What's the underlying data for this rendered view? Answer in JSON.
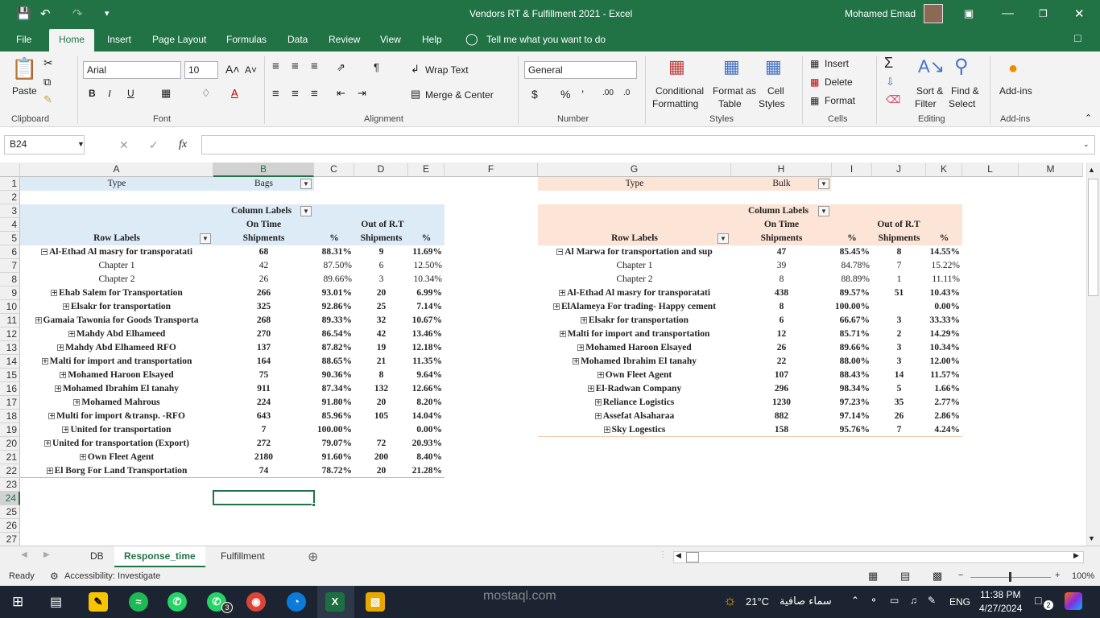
{
  "window": {
    "title": "Vendors RT & Fulfillment 2021  -  Excel",
    "user": "Mohamed Emad"
  },
  "tabs": [
    "File",
    "Home",
    "Insert",
    "Page Layout",
    "Formulas",
    "Data",
    "Review",
    "View",
    "Help"
  ],
  "tell_me": "Tell me what you want to do",
  "ribbon": {
    "paste": "Paste",
    "clipboard": "Clipboard",
    "font_name": "Arial",
    "font_size": "10",
    "font": "Font",
    "wrap_text": "Wrap Text",
    "merge_center": "Merge & Center",
    "alignment": "Alignment",
    "number_format": "General",
    "number": "Number",
    "conditional": "Conditional",
    "formatting": "Formatting",
    "format_as": "Format as",
    "table": "Table",
    "cell": "Cell",
    "styles_btn": "Styles",
    "styles": "Styles",
    "insert": "Insert",
    "delete": "Delete",
    "format": "Format",
    "cells": "Cells",
    "sort": "Sort &",
    "filter": "Filter",
    "find": "Find &",
    "select": "Select",
    "editing": "Editing",
    "addins": "Add-ins",
    "addins_grp": "Add-ins"
  },
  "formula": {
    "namebox": "B24",
    "value": ""
  },
  "columns": [
    "A",
    "B",
    "C",
    "D",
    "E",
    "F",
    "G",
    "H",
    "I",
    "J",
    "K",
    "L",
    "M"
  ],
  "rows": [
    "1",
    "2",
    "3",
    "4",
    "5",
    "6",
    "7",
    "8",
    "9",
    "10",
    "11",
    "12",
    "13",
    "14",
    "15",
    "16",
    "17",
    "18",
    "19",
    "20",
    "21",
    "22",
    "23",
    "24",
    "25",
    "26",
    "27"
  ],
  "left": {
    "type_label": "Type",
    "type_value": "Bags",
    "column_labels": "Column Labels",
    "on_time": "On Time",
    "out_of": "Out of R.T",
    "row_labels": "Row Labels",
    "shipments": "Shipments",
    "pct": "%",
    "rows": [
      [
        "Al-Ethad Al masry for transporatati",
        "68",
        "88.31%",
        "9",
        "11.69%",
        "minus",
        1
      ],
      [
        "Chapter 1",
        "42",
        "87.50%",
        "6",
        "12.50%",
        "",
        0
      ],
      [
        "Chapter 2",
        "26",
        "89.66%",
        "3",
        "10.34%",
        "",
        0
      ],
      [
        "Ehab Salem for Transportation",
        "266",
        "93.01%",
        "20",
        "6.99%",
        "plus",
        1
      ],
      [
        "Elsakr for transportation",
        "325",
        "92.86%",
        "25",
        "7.14%",
        "plus",
        1
      ],
      [
        "Gamaia Tawonia for Goods Transporta",
        "268",
        "89.33%",
        "32",
        "10.67%",
        "plus",
        1
      ],
      [
        "Mahdy Abd Elhameed",
        "270",
        "86.54%",
        "42",
        "13.46%",
        "plus",
        1
      ],
      [
        "Mahdy Abd Elhameed RFO",
        "137",
        "87.82%",
        "19",
        "12.18%",
        "plus",
        1
      ],
      [
        "Malti for import and transportation",
        "164",
        "88.65%",
        "21",
        "11.35%",
        "plus",
        1
      ],
      [
        "Mohamed Haroon Elsayed",
        "75",
        "90.36%",
        "8",
        "9.64%",
        "plus",
        1
      ],
      [
        "Mohamed Ibrahim El tanahy",
        "911",
        "87.34%",
        "132",
        "12.66%",
        "plus",
        1
      ],
      [
        "Mohamed Mahrous",
        "224",
        "91.80%",
        "20",
        "8.20%",
        "plus",
        1
      ],
      [
        "Multi for import &transp. -RFO",
        "643",
        "85.96%",
        "105",
        "14.04%",
        "plus",
        1
      ],
      [
        "United for transportation",
        "7",
        "100.00%",
        "",
        "0.00%",
        "plus",
        1
      ],
      [
        "United for transportation (Export)",
        "272",
        "79.07%",
        "72",
        "20.93%",
        "plus",
        1
      ],
      [
        "Own Fleet Agent",
        "2180",
        "91.60%",
        "200",
        "8.40%",
        "plus",
        1
      ],
      [
        "El Borg For Land Transportation",
        "74",
        "78.72%",
        "20",
        "21.28%",
        "plus",
        1
      ]
    ]
  },
  "right": {
    "type_label": "Type",
    "type_value": "Bulk",
    "column_labels": "Column Labels",
    "on_time": "On Time",
    "out_of": "Out of R.T",
    "row_labels": "Row Labels",
    "shipments": "Shipments",
    "pct": "%",
    "rows": [
      [
        "Al Marwa for transportation and sup",
        "47",
        "85.45%",
        "8",
        "14.55%",
        "minus",
        1
      ],
      [
        "Chapter 1",
        "39",
        "84.78%",
        "7",
        "15.22%",
        "",
        0
      ],
      [
        "Chapter 2",
        "8",
        "88.89%",
        "1",
        "11.11%",
        "",
        0
      ],
      [
        "Al-Ethad Al masry for transporatati",
        "438",
        "89.57%",
        "51",
        "10.43%",
        "plus",
        1
      ],
      [
        "ElAlameya For trading- Happy cement",
        "8",
        "100.00%",
        "",
        "0.00%",
        "plus",
        1
      ],
      [
        "Elsakr for transportation",
        "6",
        "66.67%",
        "3",
        "33.33%",
        "plus",
        1
      ],
      [
        "Malti for import and transportation",
        "12",
        "85.71%",
        "2",
        "14.29%",
        "plus",
        1
      ],
      [
        "Mohamed Haroon Elsayed",
        "26",
        "89.66%",
        "3",
        "10.34%",
        "plus",
        1
      ],
      [
        "Mohamed Ibrahim El tanahy",
        "22",
        "88.00%",
        "3",
        "12.00%",
        "plus",
        1
      ],
      [
        "Own Fleet Agent",
        "107",
        "88.43%",
        "14",
        "11.57%",
        "plus",
        1
      ],
      [
        "El-Radwan Company",
        "296",
        "98.34%",
        "5",
        "1.66%",
        "plus",
        1
      ],
      [
        "Reliance Logistics",
        "1230",
        "97.23%",
        "35",
        "2.77%",
        "plus",
        1
      ],
      [
        "Assefat Alsaharaa",
        "882",
        "97.14%",
        "26",
        "2.86%",
        "plus",
        1
      ],
      [
        "Sky Logestics",
        "158",
        "95.76%",
        "7",
        "4.24%",
        "plus",
        1
      ]
    ]
  },
  "sheets": [
    "DB",
    "Response_time",
    "Fulfillment"
  ],
  "status": {
    "ready": "Ready",
    "accessibility": "Accessibility: Investigate",
    "zoom": "100%"
  },
  "taskbar": {
    "weather": "21°C",
    "weather_desc": "سماء صافية",
    "lang": "ENG",
    "time": "11:38 PM",
    "date": "4/27/2024",
    "notif": "2",
    "badge": "3"
  },
  "watermark": "mostaql.com"
}
